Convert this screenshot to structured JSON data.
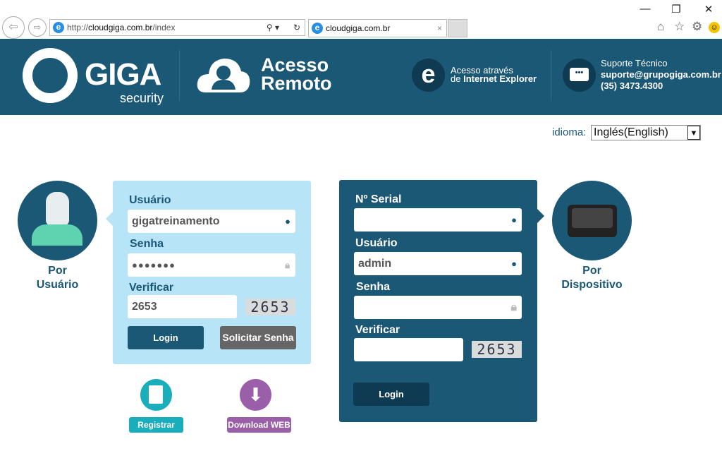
{
  "browser": {
    "url_domain": "cloudgiga.com.br",
    "url_prefix": "http://",
    "url_path": "/index",
    "tab_title": "cloudgiga.com.br"
  },
  "header": {
    "brand": "GIGA",
    "brand_sub": "security",
    "title_line1": "Acesso",
    "title_line2": "Remoto",
    "ie_line1": "Acesso através",
    "ie_line2_prefix": "de ",
    "ie_line2_bold": "Internet Explorer",
    "support_title": "Suporte Técnico",
    "support_email": "suporte@grupogiga.com.br",
    "support_phone": "(35) 3473.4300"
  },
  "language": {
    "label": "idioma:",
    "selected": "Inglés(English)"
  },
  "user_login": {
    "side_label_1": "Por",
    "side_label_2": "Usuário",
    "user_label": "Usuário",
    "user_value": "gigatreinamento",
    "password_label": "Senha",
    "password_value": "●●●●●●●",
    "verify_label": "Verificar",
    "verify_value": "2653",
    "captcha": "2653",
    "login_label": "Login",
    "request_label": "Solicitar Senha"
  },
  "device_login": {
    "side_label_1": "Por",
    "side_label_2": "Dispositivo",
    "serial_label": "Nº Serial",
    "serial_value": "",
    "user_label": "Usuário",
    "user_value": "admin",
    "password_label": "Senha",
    "password_value": "",
    "verify_label": "Verificar",
    "verify_value": "",
    "captcha": "2653",
    "login_label": "Login"
  },
  "actions": {
    "register_label": "Registrar",
    "download_label": "Download WEB"
  },
  "colors": {
    "header": "#1b5876",
    "user_panel": "#b8e4f8",
    "device_panel": "#1b5876",
    "register": "#1aadbb",
    "download": "#9a5fa8"
  }
}
